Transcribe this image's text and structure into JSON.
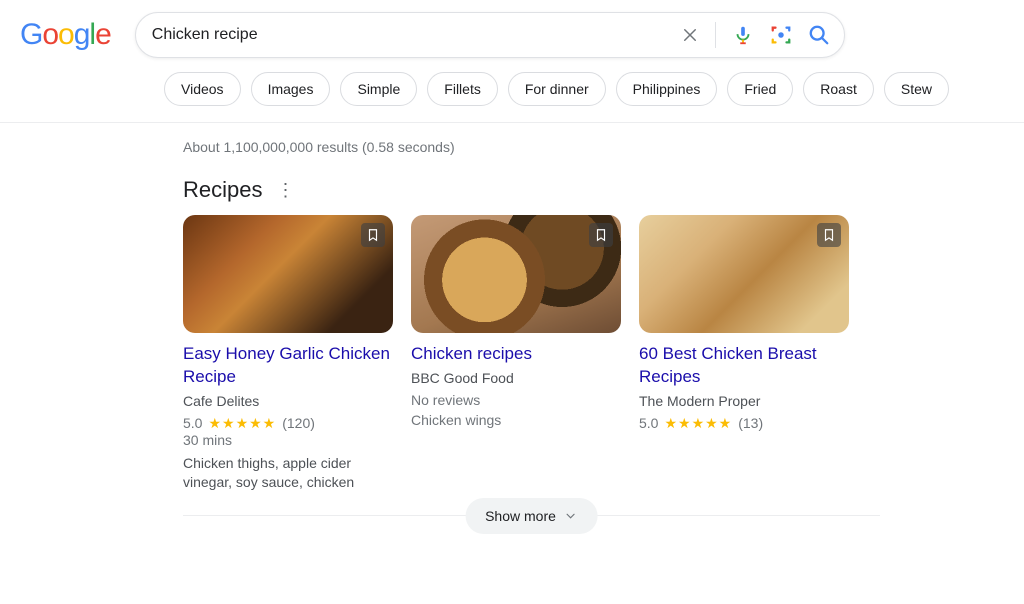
{
  "search": {
    "query": "Chicken recipe"
  },
  "chips": [
    "Videos",
    "Images",
    "Simple",
    "Fillets",
    "For dinner",
    "Philippines",
    "Fried",
    "Roast",
    "Stew"
  ],
  "result_stats": "About 1,100,000,000 results (0.58 seconds)",
  "section_title": "Recipes",
  "cards": [
    {
      "title": "Easy Honey Garlic Chicken Recipe",
      "source": "Cafe Delites",
      "rating": "5.0",
      "reviews": "(120)",
      "time": "30 mins",
      "ingredients": "Chicken thighs, apple cider vinegar, soy sauce, chicken",
      "no_reviews": null,
      "category": null
    },
    {
      "title": "Chicken recipes",
      "source": "BBC Good Food",
      "rating": null,
      "reviews": null,
      "time": null,
      "ingredients": null,
      "no_reviews": "No reviews",
      "category": "Chicken wings"
    },
    {
      "title": "60 Best Chicken Breast Recipes",
      "source": "The Modern Proper",
      "rating": "5.0",
      "reviews": "(13)",
      "time": null,
      "ingredients": null,
      "no_reviews": null,
      "category": null
    }
  ],
  "show_more": "Show more"
}
